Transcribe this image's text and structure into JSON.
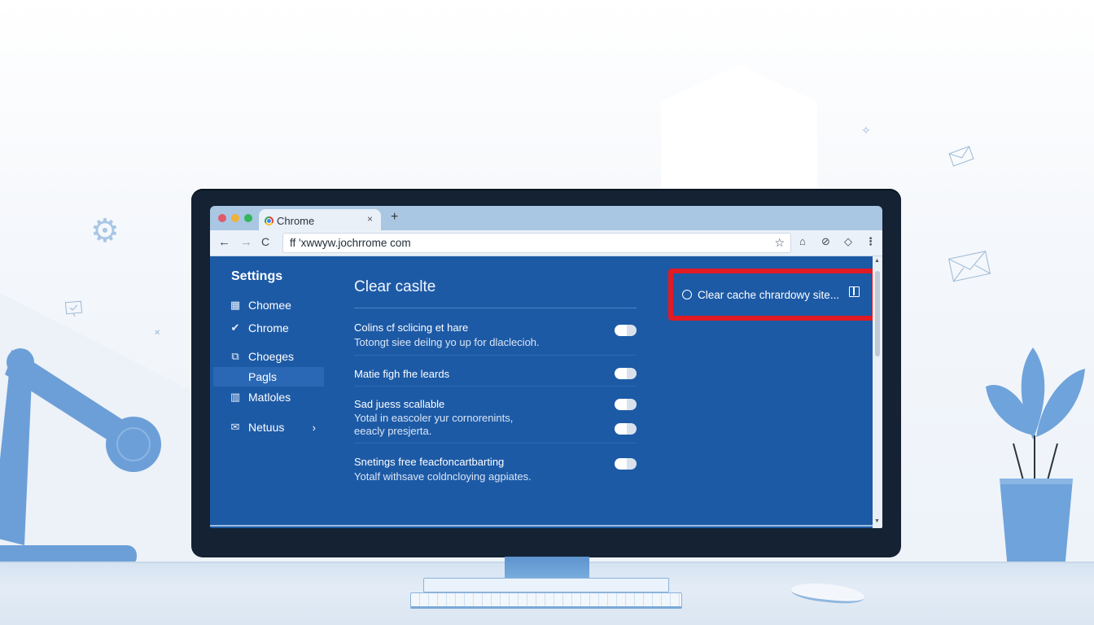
{
  "browser": {
    "tab": {
      "title": "Chrome",
      "close_icon": "×",
      "new_tab_icon": "+"
    },
    "toolbar": {
      "back_icon": "←",
      "forward_icon": "→",
      "reload_icon": "C",
      "url": "ff 'xwwyw.jochrrome com",
      "bookmark_icon": "☆",
      "extension_icons": [
        "⌂",
        "⊘",
        "◇"
      ],
      "menu_icon": "⋮"
    }
  },
  "sidebar": {
    "title": "Settings",
    "items": [
      {
        "label": "Chomee",
        "icon": "▦"
      },
      {
        "label": "Chrome",
        "icon": "✔"
      },
      {
        "label": "Choeges",
        "icon": "⧉"
      },
      {
        "label": "Pagls",
        "icon": "",
        "active": true
      },
      {
        "label": "Matloles",
        "icon": "▥"
      },
      {
        "label": "Netuus",
        "icon": "✉",
        "chevron": "›"
      }
    ]
  },
  "main": {
    "title": "Clear caslte",
    "options": [
      {
        "title": "Colins cf sclicing et hare",
        "desc": [
          "Totongt siee deilng yo up for dlaclecioh."
        ],
        "toggles": 1
      },
      {
        "title": "Matie figh fhe leards",
        "desc": [],
        "toggles": 1
      },
      {
        "title": "Sad juess scallable",
        "desc": [
          "Yotal in eascoler yur cornorenints,",
          "eeacly presjerta."
        ],
        "toggles": 2
      },
      {
        "title": "Snetings free feacfoncartbarting",
        "desc": [
          "Yotalf withsave coldncloying agpiates."
        ],
        "toggles": 1
      }
    ]
  },
  "popup": {
    "label": "Clear cache chrardowy site...",
    "radio_icon": "radio-circle",
    "panel_icon": "side-panel-icon",
    "highlight_color": "#e01b24"
  },
  "colors": {
    "content_bg": "#1d5aa6",
    "tabstrip_bg": "#a9c6e2",
    "bezel": "#142233",
    "accent_light": "#a8c6e6"
  }
}
